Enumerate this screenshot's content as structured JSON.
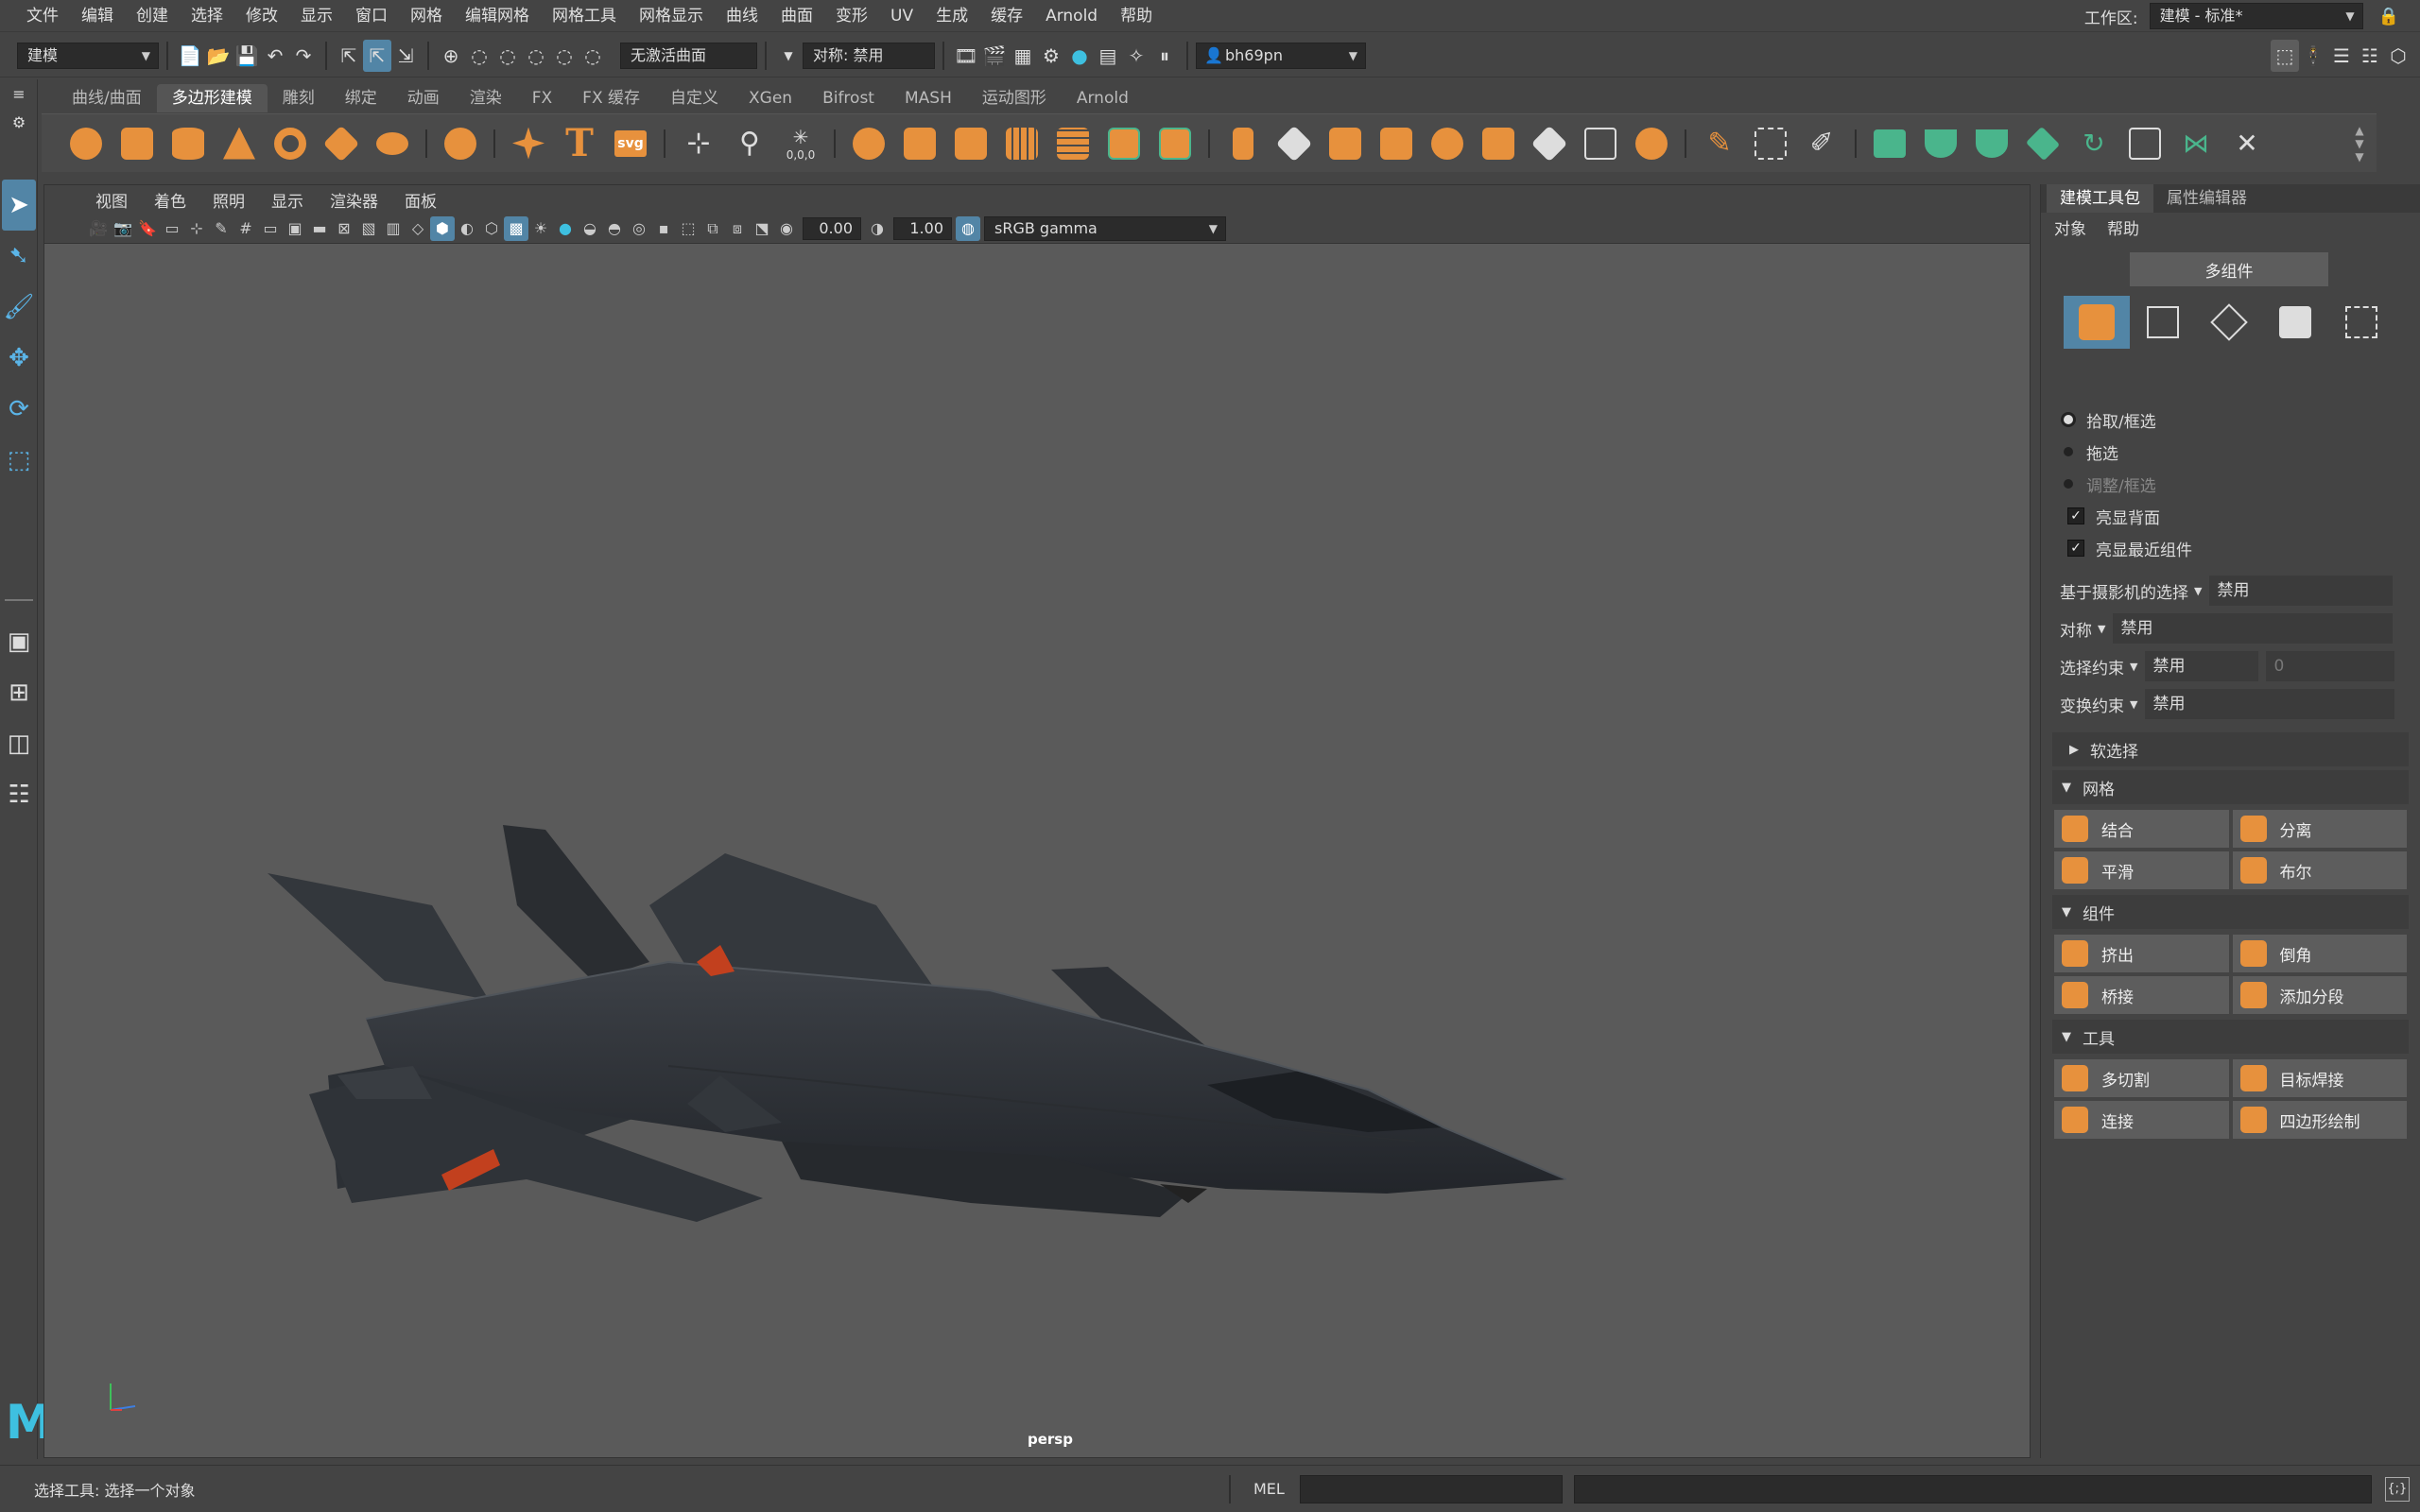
{
  "menubar": {
    "items": [
      "文件",
      "编辑",
      "创建",
      "选择",
      "修改",
      "显示",
      "窗口",
      "网格",
      "编辑网格",
      "网格工具",
      "网格显示",
      "曲线",
      "曲面",
      "变形",
      "UV",
      "生成",
      "缓存",
      "Arnold",
      "帮助"
    ],
    "workspace_label": "工作区:",
    "workspace_value": "建模 - 标准*"
  },
  "statusline": {
    "mode": "建模",
    "no_live_surface": "无激活曲面",
    "symmetry": "对称: 禁用",
    "user": "bh69pn"
  },
  "shelf": {
    "tabs": [
      "曲线/曲面",
      "多边形建模",
      "雕刻",
      "绑定",
      "动画",
      "渲染",
      "FX",
      "FX 缓存",
      "自定义",
      "XGen",
      "Bifrost",
      "MASH",
      "运动图形",
      "Arnold"
    ],
    "active_tab": "多边形建模",
    "text_icon": "T",
    "svg_icon": "svg",
    "coords_label": "0,0,0"
  },
  "viewport": {
    "menu": [
      "视图",
      "着色",
      "照明",
      "显示",
      "渲染器",
      "面板"
    ],
    "exposure": "0.00",
    "gamma": "1.00",
    "color_space": "sRGB gamma",
    "camera_label": "persp"
  },
  "panel": {
    "tabs": [
      "建模工具包",
      "属性编辑器"
    ],
    "submenu": [
      "对象",
      "帮助"
    ],
    "multi_component": "多组件",
    "selection_modes": [
      "拾取/框选",
      "拖选",
      "调整/框选"
    ],
    "checks": [
      "亮显背面",
      "亮显最近组件"
    ],
    "fields": [
      {
        "label": "基于摄影机的选择",
        "value": "禁用"
      },
      {
        "label": "对称",
        "value": "禁用"
      },
      {
        "label": "选择约束",
        "value": "禁用",
        "extra": "0"
      },
      {
        "label": "变换约束",
        "value": "禁用"
      }
    ],
    "soft_select": "软选择",
    "sections": [
      {
        "title": "网格",
        "buttons": [
          "结合",
          "分离",
          "平滑",
          "布尔"
        ]
      },
      {
        "title": "组件",
        "buttons": [
          "挤出",
          "倒角",
          "桥接",
          "添加分段"
        ]
      },
      {
        "title": "工具",
        "buttons": [
          "多切割",
          "目标焊接",
          "连接",
          "四边形绘制"
        ]
      }
    ]
  },
  "bottom": {
    "help_line": "选择工具: 选择一个对象",
    "script_type": "MEL"
  },
  "colors": {
    "accent_orange": "#e7913d",
    "accent_blue": "#5285a6",
    "accent_green": "#4ab58c"
  }
}
